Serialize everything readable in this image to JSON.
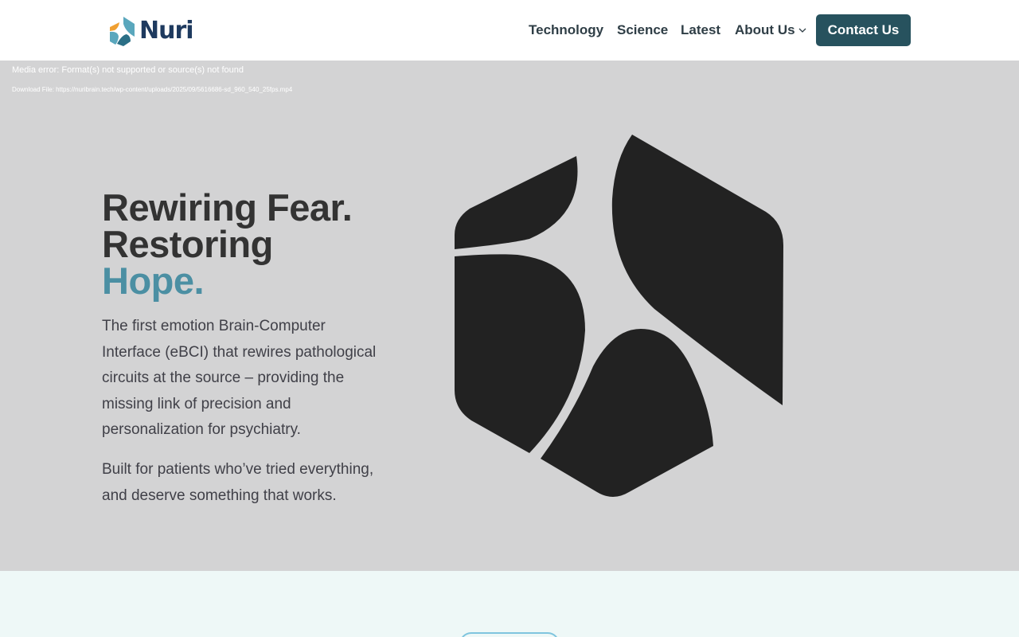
{
  "brand": {
    "name": "Nuri",
    "colors": {
      "navy": "#1e3a5f",
      "teal": "#5aa7bd",
      "orange": "#f0a032",
      "accent": "#4b8fa3",
      "button": "#27525e"
    }
  },
  "nav": {
    "items": [
      {
        "label": "Technology"
      },
      {
        "label": "Science"
      },
      {
        "label": "Latest"
      },
      {
        "label": "About Us",
        "icon": "chevron-down-icon"
      }
    ],
    "cta": "Contact Us"
  },
  "media": {
    "error": "Media error: Format(s) not supported or source(s) not found",
    "download_prefix": "Download File: ",
    "download_url": "https://nuribrain.tech/wp-content/uploads/2025/09/5616686-sd_960_540_25fps.mp4"
  },
  "hero": {
    "title_line1": "Rewiring Fear.",
    "title_line2": "Restoring",
    "title_line3": "Hope.",
    "paragraph1": "The first emotion Brain-Computer Interface (eBCI) that rewires pathological circuits at the source – providing the missing link of precision and personalization for psychiatry.",
    "paragraph2": "Built for patients who’ve tried everything, and deserve something that works."
  }
}
